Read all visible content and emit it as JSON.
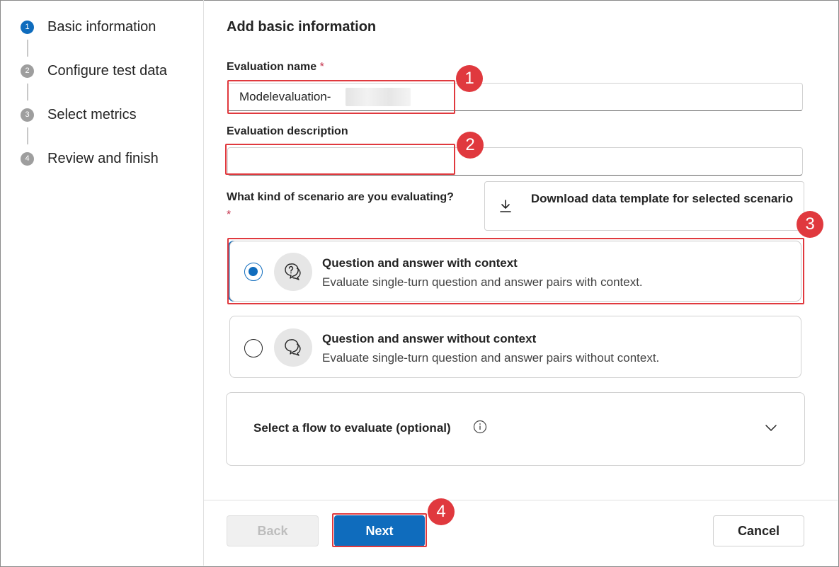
{
  "steps": [
    {
      "number": "1",
      "label": "Basic information",
      "active": true
    },
    {
      "number": "2",
      "label": "Configure test data",
      "active": false
    },
    {
      "number": "3",
      "label": "Select metrics",
      "active": false
    },
    {
      "number": "4",
      "label": "Review and finish",
      "active": false
    }
  ],
  "form": {
    "heading": "Add basic information",
    "name_label": "Evaluation name",
    "name_value": "Modelevaluation-",
    "required_mark": "*",
    "description_label": "Evaluation description",
    "description_value": "",
    "scenario_question": "What kind of scenario are you evaluating?",
    "download_button": "Download data template for selected scenario"
  },
  "scenarios": [
    {
      "title": "Question and answer with context",
      "description": "Evaluate single-turn question and answer pairs with context.",
      "selected": true
    },
    {
      "title": "Question and answer without context",
      "description": "Evaluate single-turn question and answer pairs without context.",
      "selected": false
    }
  ],
  "flow": {
    "label": "Select a flow to evaluate (optional)"
  },
  "footer": {
    "back": "Back",
    "next": "Next",
    "cancel": "Cancel"
  },
  "annotations": [
    "1",
    "2",
    "3",
    "4"
  ],
  "colors": {
    "accent": "#0f6cbd",
    "annotation": "#e0393e",
    "required": "#c4314b"
  }
}
